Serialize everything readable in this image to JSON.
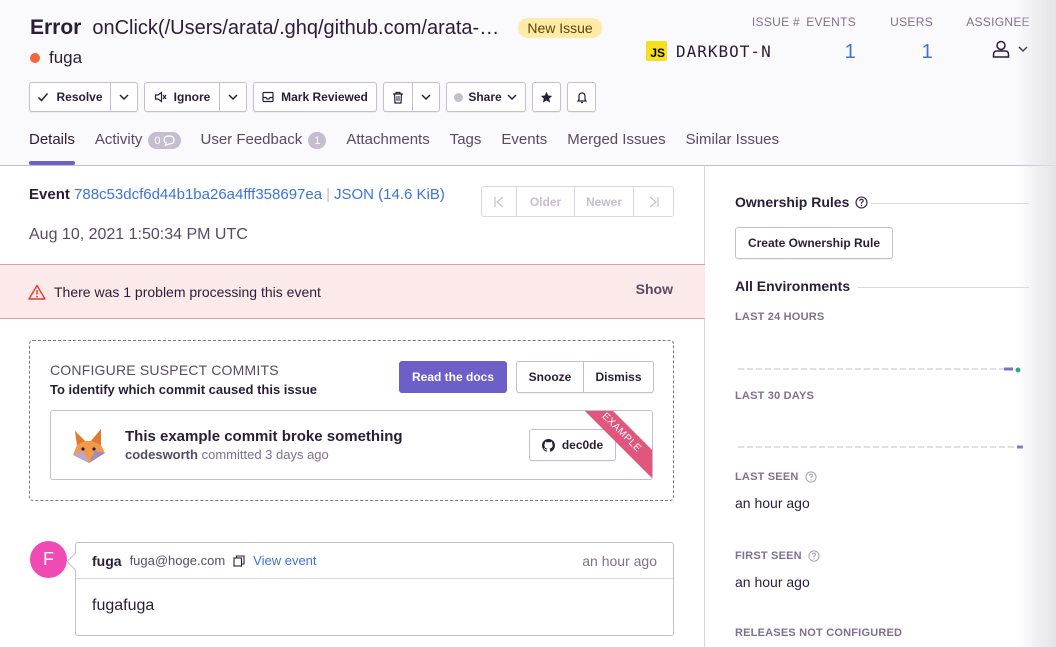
{
  "header": {
    "error_type": "Error",
    "error_message": "onClick(/Users/arata/.ghq/github.com/arata-honda/darkbot-n/src/components/...",
    "new_issue_badge": "New Issue",
    "subtitle": "fuga",
    "level_color": "#f2663b",
    "stats": {
      "issue_label": "ISSUE #",
      "issue_project_badge": "JS",
      "issue_project_name": "DARKBOT-N",
      "events_label": "EVENTS",
      "events_value": "1",
      "users_label": "USERS",
      "users_value": "1",
      "assignee_label": "ASSIGNEE"
    }
  },
  "toolbar": {
    "resolve": "Resolve",
    "ignore": "Ignore",
    "mark_reviewed": "Mark Reviewed",
    "share": "Share"
  },
  "tabs": [
    {
      "label": "Details"
    },
    {
      "label": "Activity",
      "count": "0"
    },
    {
      "label": "User Feedback",
      "count": "1"
    },
    {
      "label": "Attachments"
    },
    {
      "label": "Tags"
    },
    {
      "label": "Events"
    },
    {
      "label": "Merged Issues"
    },
    {
      "label": "Similar Issues"
    }
  ],
  "event": {
    "label": "Event",
    "id": "788c53dcf6d44b1ba26a4fff358697ea",
    "json_link": "JSON (14.6 KiB)",
    "date": "Aug 10, 2021 1:50:34 PM UTC",
    "pager": {
      "older": "Older",
      "newer": "Newer"
    }
  },
  "alert": {
    "message": "There was 1 problem processing this event",
    "action": "Show"
  },
  "suspect_commits": {
    "title": "CONFIGURE SUSPECT COMMITS",
    "description": "To identify which commit caused this issue",
    "read_docs": "Read the docs",
    "snooze": "Snooze",
    "dismiss": "Dismiss",
    "example": {
      "title": "This example commit broke something",
      "author": "codesworth",
      "meta": "committed 3 days ago",
      "hash": "dec0de",
      "ribbon": "EXAMPLE"
    }
  },
  "activity": {
    "avatar_letter": "F",
    "user": "fuga",
    "email": "fuga@hoge.com",
    "view_event": "View event",
    "time": "an hour ago",
    "body": "fugafuga"
  },
  "sidebar": {
    "ownership_title": "Ownership Rules",
    "create_ownership_rule": "Create Ownership Rule",
    "environments_title": "All Environments",
    "last_24_hours": "LAST 24 HOURS",
    "last_30_days": "LAST 30 DAYS",
    "last_seen_label": "LAST SEEN",
    "last_seen_value": "an hour ago",
    "first_seen_label": "FIRST SEEN",
    "first_seen_value": "an hour ago",
    "releases_label": "RELEASES NOT CONFIGURED"
  },
  "colors": {
    "accent": "#6c5fc7",
    "link": "#3d74db",
    "alert_bg": "#fce9e9",
    "avatar": "#f04ab5"
  }
}
